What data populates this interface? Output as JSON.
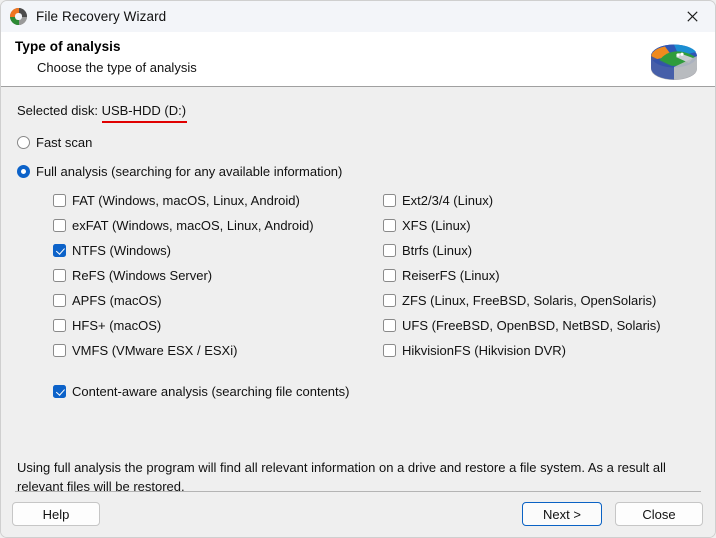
{
  "titlebar": {
    "app_icon": "app-logo-icon",
    "title": "File Recovery Wizard",
    "close_label": "close-icon"
  },
  "header": {
    "title": "Type of analysis",
    "subtitle": "Choose the type of analysis",
    "logo_icon": "disk-platter-icon"
  },
  "body": {
    "selected_disk_label": "Selected disk:",
    "selected_disk_value": "USB-HDD (D:)",
    "annotation_color": "#e00000",
    "scan_modes": [
      {
        "label": "Fast scan",
        "checked": false
      },
      {
        "label": "Full analysis (searching for any available information)",
        "checked": true
      }
    ],
    "filesystems_left": [
      {
        "label": "FAT (Windows, macOS, Linux, Android)",
        "checked": false
      },
      {
        "label": "exFAT (Windows, macOS, Linux, Android)",
        "checked": false
      },
      {
        "label": "NTFS (Windows)",
        "checked": true
      },
      {
        "label": "ReFS (Windows Server)",
        "checked": false
      },
      {
        "label": "APFS (macOS)",
        "checked": false
      },
      {
        "label": "HFS+ (macOS)",
        "checked": false
      },
      {
        "label": "VMFS (VMware ESX / ESXi)",
        "checked": false
      }
    ],
    "filesystems_right": [
      {
        "label": "Ext2/3/4 (Linux)",
        "checked": false
      },
      {
        "label": "XFS (Linux)",
        "checked": false
      },
      {
        "label": "Btrfs (Linux)",
        "checked": false
      },
      {
        "label": "ReiserFS (Linux)",
        "checked": false
      },
      {
        "label": "ZFS (Linux, FreeBSD, Solaris, OpenSolaris)",
        "checked": false
      },
      {
        "label": "UFS (FreeBSD, OpenBSD, NetBSD, Solaris)",
        "checked": false
      },
      {
        "label": "HikvisionFS (Hikvision DVR)",
        "checked": false
      }
    ],
    "content_aware": {
      "label": "Content-aware analysis (searching file contents)",
      "checked": true
    },
    "description": "Using full analysis the program will find all relevant information on a drive and restore a file system. As a result all relevant files will be restored."
  },
  "footer": {
    "help_label": "Help",
    "next_label": "Next >",
    "close_label": "Close",
    "accent_color": "#0a62c4"
  }
}
